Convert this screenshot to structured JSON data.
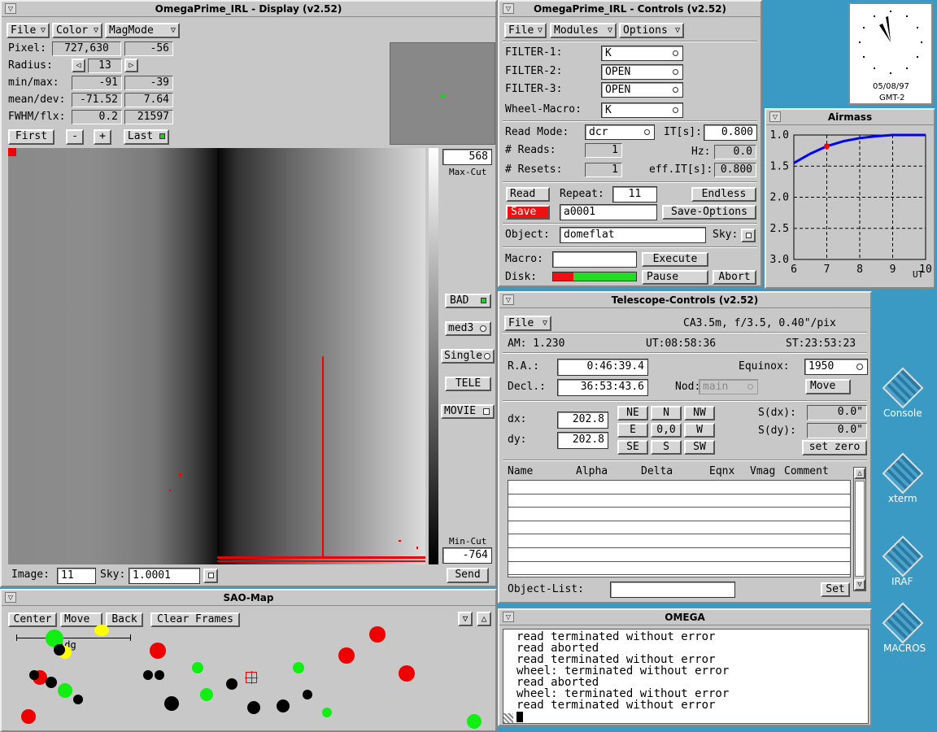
{
  "display": {
    "title": "OmegaPrime_IRL - Display (v2.52)",
    "menus": [
      "File",
      "Color",
      "MagMode"
    ],
    "pixel_label": "Pixel:",
    "pixel_value": "727,630",
    "pixel_count": "-56",
    "radius_label": "Radius:",
    "radius_value": "13",
    "minmax_label": "min/max:",
    "min": "-91",
    "max": "-39",
    "meandev_label": "mean/dev:",
    "mean": "-71.52",
    "dev": "7.64",
    "fwhm_label": "FWHM/flx:",
    "fwhm": "0.2",
    "flux": "21597",
    "first": "First",
    "minus": "-",
    "plus": "+",
    "last": "Last",
    "max_cut": "568",
    "max_cut_label": "Max-Cut",
    "min_cut": "-764",
    "min_cut_label": "Min-Cut",
    "bad": "BAD",
    "med3": "med3",
    "single": "Single",
    "tele": "TELE",
    "movie": "MOVIE",
    "image_label": "Image:",
    "image_value": "11",
    "sky_label": "Sky:",
    "sky_value": "1.0001",
    "send": "Send"
  },
  "controls": {
    "title": "OmegaPrime_IRL - Controls (v2.52)",
    "menus": [
      "File",
      "Modules",
      "Options"
    ],
    "filter1_label": "FILTER-1:",
    "filter1": "K",
    "filter2_label": "FILTER-2:",
    "filter2": "OPEN",
    "filter3_label": "FILTER-3:",
    "filter3": "OPEN",
    "wheel_label": "Wheel-Macro:",
    "wheel": "K",
    "readmode_label": "Read Mode:",
    "readmode": "dcr",
    "it_label": "IT[s]:",
    "it": "0.800",
    "reads_label": "# Reads:",
    "reads": "1",
    "hz_label": "Hz:",
    "hz": "0.0",
    "resets_label": "# Resets:",
    "resets": "1",
    "effit_label": "eff.IT[s]:",
    "effit": "0.800",
    "read": "Read",
    "repeat_label": "Repeat:",
    "repeat": "11",
    "endless": "Endless",
    "save": "Save",
    "filename": "a0001",
    "save_options": "Save-Options",
    "object_label": "Object:",
    "object": "domeflat",
    "sky_label": "Sky:",
    "macro_label": "Macro:",
    "macro": "",
    "execute": "Execute",
    "disk_label": "Disk:",
    "pause": "Pause",
    "abort": "Abort"
  },
  "clock": {
    "date": "05/08/97",
    "tz": "GMT-2"
  },
  "airmass": {
    "title": "Airmass",
    "yticks": [
      "1.0",
      "1.5",
      "2.0",
      "2.5",
      "3.0"
    ],
    "xticks": [
      "6",
      "7",
      "8",
      "9",
      "10"
    ],
    "xunit": "UT",
    "curve": [
      [
        6.0,
        1.45
      ],
      [
        6.5,
        1.3
      ],
      [
        7.0,
        1.18
      ],
      [
        7.5,
        1.1
      ],
      [
        8.0,
        1.05
      ],
      [
        8.5,
        1.02
      ],
      [
        9.0,
        1.0
      ],
      [
        9.5,
        1.0
      ],
      [
        10.0,
        1.0
      ]
    ],
    "marker": [
      7.0,
      1.18
    ],
    "curve_color": "#0000ff",
    "marker_color": "#ff0000"
  },
  "telescope": {
    "title": "Telescope-Controls (v2.52)",
    "menu": "File",
    "instrument": "CA3.5m, f/3.5, 0.40\"/pix",
    "am": "AM: 1.230",
    "ut": "UT:08:58:36",
    "st": "ST:23:53:23",
    "ra_label": "R.A.:",
    "ra": "0:46:39.4",
    "equinox_label": "Equinox:",
    "equinox": "1950",
    "decl_label": "Decl.:",
    "decl": "36:53:43.6",
    "nod_label": "Nod:",
    "nod": "main",
    "move": "Move",
    "dx_label": "dx:",
    "dx": "202.8",
    "dy_label": "dy:",
    "dy": "202.8",
    "dirs": [
      "NE",
      "N",
      "NW",
      "E",
      "0,0",
      "W",
      "SE",
      "S",
      "SW"
    ],
    "sdx_label": "S(dx):",
    "sdx": "0.0\"",
    "sdy_label": "S(dy):",
    "sdy": "0.0\"",
    "set_zero": "set zero",
    "cols": [
      "Name",
      "Alpha",
      "Delta",
      "Eqnx",
      "Vmag",
      "Comment"
    ],
    "objlist_label": "Object-List:",
    "objlist": "",
    "set": "Set"
  },
  "saomap": {
    "title": "SAO-Map",
    "center": "Center",
    "move": "Move",
    "back": "Back",
    "clear": "Clear Frames",
    "scale_label": "1dg"
  },
  "omega": {
    "title": "OMEGA",
    "log": [
      "read terminated without error",
      "read aborted",
      "read terminated without error",
      "wheel: terminated without error",
      "read aborted",
      "wheel: terminated without error",
      "read terminated without error"
    ]
  },
  "desktop": {
    "icons": [
      "Console",
      "xterm",
      "IRAF",
      "MACROS"
    ]
  }
}
